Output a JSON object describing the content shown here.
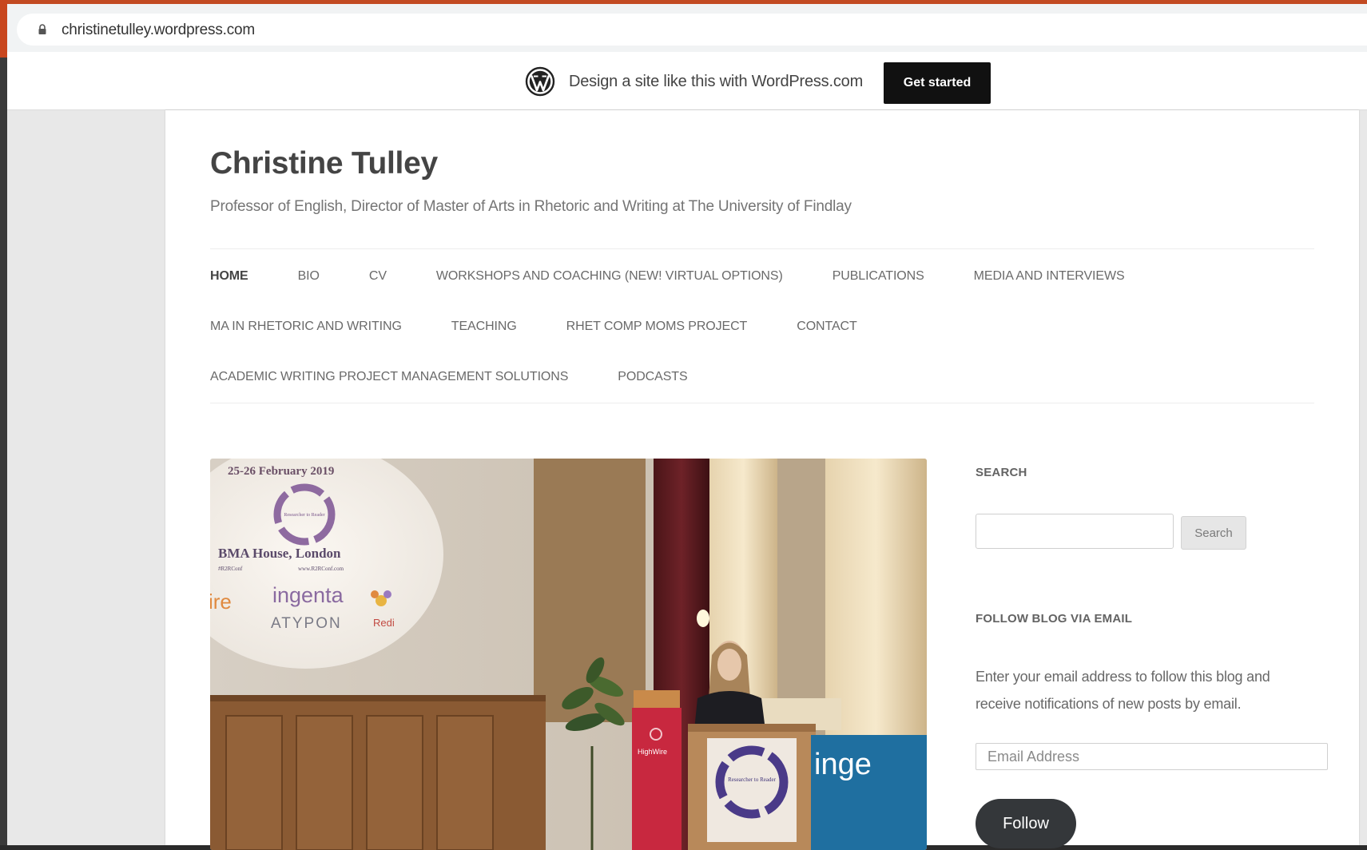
{
  "browser": {
    "url": "christinetulley.wordpress.com"
  },
  "wp_banner": {
    "text": "Design a site like this with WordPress.com",
    "cta": "Get started"
  },
  "site": {
    "title": "Christine Tulley",
    "description": "Professor of English, Director of Master of Arts in Rhetoric and Writing at The University of Findlay"
  },
  "nav": {
    "items": [
      "HOME",
      "BIO",
      "CV",
      "WORKSHOPS AND COACHING (NEW! VIRTUAL OPTIONS)",
      "PUBLICATIONS",
      "MEDIA AND INTERVIEWS",
      "MA IN RHETORIC AND WRITING",
      "TEACHING",
      "RHET COMP MOMS PROJECT",
      "CONTACT",
      "ACADEMIC WRITING PROJECT MANAGEMENT SOLUTIONS",
      "PODCASTS"
    ],
    "current": "HOME"
  },
  "featured_image": {
    "slide_date": "25-26 February 2019",
    "slide_badge": "Researcher to Reader",
    "slide_venue": "BMA House, London",
    "slide_hashtag": "#R2RConf",
    "slide_site": "www.R2RConf.com",
    "sponsor_1": "ingenta",
    "sponsor_2": "ATYPON",
    "sponsor_3": "Redi",
    "sponsor_fragment": "ire",
    "banner_fragment": "inge",
    "podium_label": "HighWire"
  },
  "sidebar": {
    "search": {
      "title": "SEARCH",
      "button": "Search"
    },
    "follow": {
      "title": "FOLLOW BLOG VIA EMAIL",
      "description": "Enter your email address to follow this blog and receive notifications of new posts by email.",
      "email_placeholder": "Email Address",
      "button": "Follow"
    }
  }
}
